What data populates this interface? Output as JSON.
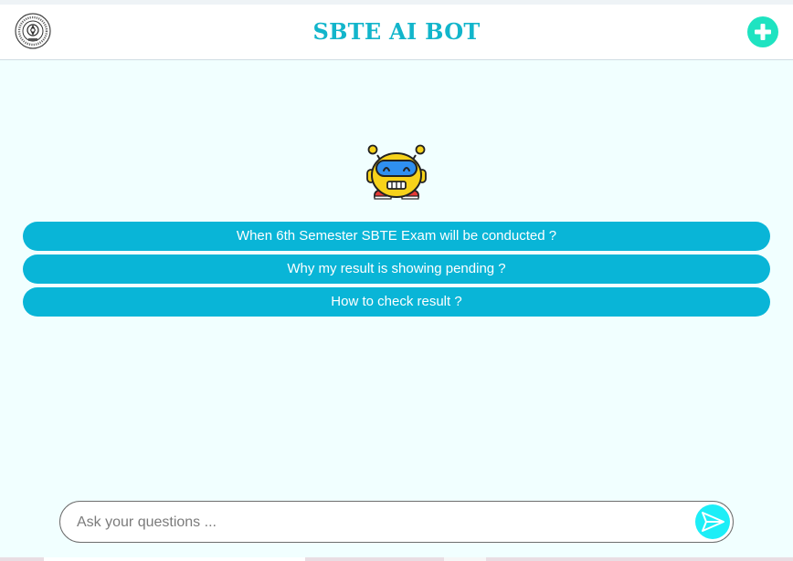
{
  "header": {
    "title": "SBTE AI BOT",
    "logo_icon": "sbte-emblem-icon",
    "new_chat_icon": "plus-circle-icon"
  },
  "mascot": {
    "icon": "robot-mascot-icon"
  },
  "suggestions": [
    {
      "label": "When 6th Semester SBTE Exam will be conducted ?"
    },
    {
      "label": "Why my result is showing pending ?"
    },
    {
      "label": "How to check result ?"
    }
  ],
  "chat_input": {
    "placeholder": "Ask your questions ...",
    "value": "",
    "send_icon": "send-icon"
  },
  "colors": {
    "page_background": "#f1ffff",
    "accent": "#09b5d7",
    "title": "#12b5cb",
    "new_chat": "#1ee3c1",
    "send_button": "#1deef7"
  }
}
